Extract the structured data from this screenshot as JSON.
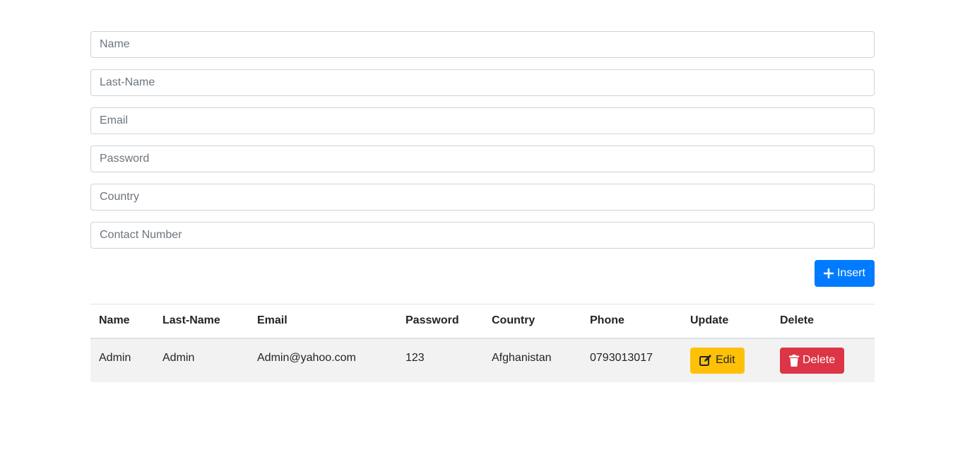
{
  "form": {
    "name_placeholder": "Name",
    "last_name_placeholder": "Last-Name",
    "email_placeholder": "Email",
    "password_placeholder": "Password",
    "country_placeholder": "Country",
    "contact_placeholder": "Contact Number",
    "insert_label": "Insert"
  },
  "table": {
    "headers": [
      "Name",
      "Last-Name",
      "Email",
      "Password",
      "Country",
      "Phone",
      "Update",
      "Delete"
    ],
    "rows": [
      {
        "name": "Admin",
        "last_name": "Admin",
        "email": "Admin@yahoo.com",
        "password": "123",
        "country": "Afghanistan",
        "phone": "0793013017",
        "edit_label": "Edit",
        "delete_label": "Delete"
      }
    ]
  },
  "icons": {
    "insert": "plus-icon",
    "edit": "edit-icon",
    "delete": "trash-icon"
  },
  "colors": {
    "primary": "#007bff",
    "warning": "#ffc107",
    "danger": "#dc3545",
    "row_stripe": "#f2f2f2"
  }
}
